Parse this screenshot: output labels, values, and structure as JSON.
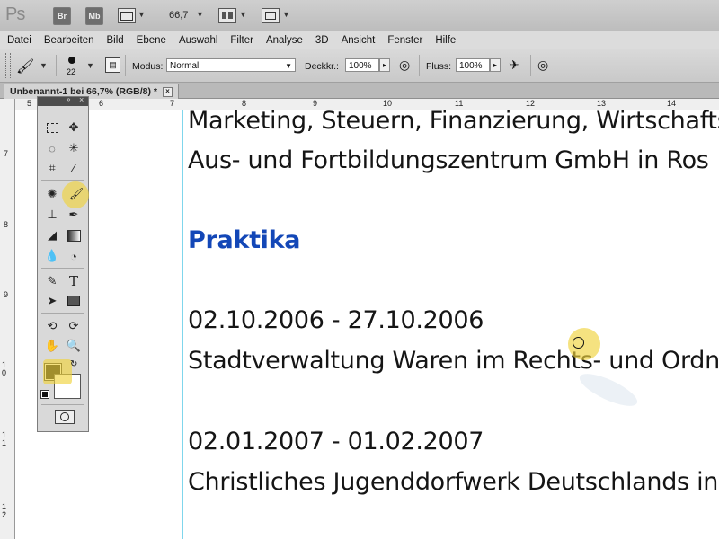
{
  "app": {
    "logo": "Ps",
    "bridge_label": "Br",
    "minibridge_label": "Mb",
    "zoom": "66,7"
  },
  "menu": [
    "Datei",
    "Bearbeiten",
    "Bild",
    "Ebene",
    "Auswahl",
    "Filter",
    "Analyse",
    "3D",
    "Ansicht",
    "Fenster",
    "Hilfe"
  ],
  "options": {
    "brush_size": "22",
    "mode_label": "Modus:",
    "mode_value": "Normal",
    "opacity_label": "Deckkr.:",
    "opacity_value": "100%",
    "flow_label": "Fluss:",
    "flow_value": "100%"
  },
  "document_tab": {
    "title": "Unbenannt-1 bei 66,7% (RGB/8) *"
  },
  "rulers": {
    "horizontal": [
      "5",
      "6",
      "7",
      "8",
      "9",
      "10",
      "11",
      "12",
      "13",
      "14"
    ],
    "vertical": [
      "7",
      "8",
      "9",
      "1 0",
      "1 1",
      "1 2"
    ]
  },
  "document": {
    "line1": "Marketing, Steuern, Finanzierung, Wirtschafts",
    "line2": "Aus- und Fortbildungszentrum GmbH in Ros",
    "heading": "Praktika",
    "date1": "02.10.2006 - 27.10.2006",
    "place1": "Stadtverwaltung Waren im Rechts- und Ordn",
    "date2": "02.01.2007 - 01.02.2007",
    "place2": "Christliches Jugenddorfwerk Deutschlands in"
  },
  "colors": {
    "heading": "#1347b7",
    "highlight": "#f0d23c",
    "guide": "#7fd6ec"
  }
}
